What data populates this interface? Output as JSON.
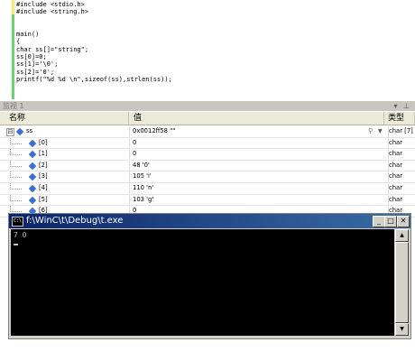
{
  "editor": {
    "lines": [
      {
        "kind": "dir",
        "text": "#include <stdio.h>"
      },
      {
        "kind": "dir",
        "text": "#include <string.h>"
      },
      {
        "kind": "blank",
        "text": ""
      },
      {
        "kind": "blank",
        "text": ""
      },
      {
        "kind": "code",
        "text": "main()"
      },
      {
        "kind": "code",
        "text": "{"
      },
      {
        "kind": "code",
        "text": "char ss[]=\"string\";"
      },
      {
        "kind": "code",
        "text": "ss[0]=0;"
      },
      {
        "kind": "code",
        "text": "ss[1]='\\0';"
      },
      {
        "kind": "code",
        "text": "ss[2]='0';"
      },
      {
        "kind": "code",
        "text": "printf(\"%d %d \\n\",sizeof(ss),strlen(ss));"
      }
    ]
  },
  "watch": {
    "title": "监视 1",
    "controls": "▾ ⊥",
    "columns": {
      "name": "名称",
      "value": "值",
      "type": "类型"
    },
    "root": {
      "name": "ss",
      "value": "0x0012ff58 \"\"",
      "type": "char [7]",
      "expander": "⊟"
    },
    "children": [
      {
        "name": "[0]",
        "value": "0",
        "type": "char"
      },
      {
        "name": "[1]",
        "value": "0",
        "type": "char"
      },
      {
        "name": "[2]",
        "value": "48 '0'",
        "type": "char"
      },
      {
        "name": "[3]",
        "value": "105 'i'",
        "type": "char"
      },
      {
        "name": "[4]",
        "value": "110 'n'",
        "type": "char"
      },
      {
        "name": "[5]",
        "value": "103 'g'",
        "type": "char"
      },
      {
        "name": "[6]",
        "value": "0",
        "type": "char"
      }
    ]
  },
  "console": {
    "icon_text": "C:\\",
    "title": "f:\\WinC\\t\\Debug\\t.exe",
    "output": "7 0",
    "buttons": {
      "min": "_",
      "max": "□",
      "close": "✕"
    },
    "scroll": {
      "up": "▲",
      "down": "▼"
    }
  },
  "colors": {
    "title_bar_start": "#0a246a",
    "title_bar_end": "#3a6ea5",
    "console_bg": "#000000",
    "console_text": "#c0c0c0",
    "change_bar": "#6fd06f"
  }
}
